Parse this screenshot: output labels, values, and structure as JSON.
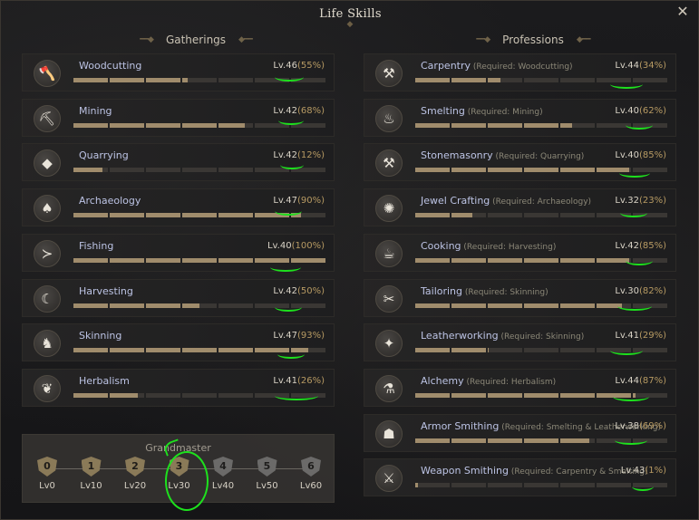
{
  "window": {
    "title": "Life Skills",
    "close_icon": "close-icon"
  },
  "gatherings": {
    "header": "Gatherings",
    "skills": [
      {
        "name": "Woodcutting",
        "level": "Lv.46",
        "percent": "(55%)",
        "progress": 0.45,
        "icon": "axe-icon"
      },
      {
        "name": "Mining",
        "level": "Lv.42",
        "percent": "(68%)",
        "progress": 0.68,
        "icon": "pickaxe-icon"
      },
      {
        "name": "Quarrying",
        "level": "Lv.42",
        "percent": "(12%)",
        "progress": 0.12,
        "icon": "rock-icon"
      },
      {
        "name": "Archaeology",
        "level": "Lv.47",
        "percent": "(90%)",
        "progress": 0.9,
        "icon": "shovel-icon"
      },
      {
        "name": "Fishing",
        "level": "Lv.40",
        "percent": "(100%)",
        "progress": 1.0,
        "icon": "fish-icon"
      },
      {
        "name": "Harvesting",
        "level": "Lv.42",
        "percent": "(50%)",
        "progress": 0.5,
        "icon": "sickle-icon"
      },
      {
        "name": "Skinning",
        "level": "Lv.47",
        "percent": "(93%)",
        "progress": 0.93,
        "icon": "bear-icon"
      },
      {
        "name": "Herbalism",
        "level": "Lv.41",
        "percent": "(26%)",
        "progress": 0.26,
        "icon": "leaf-icon"
      }
    ]
  },
  "professions": {
    "header": "Professions",
    "skills": [
      {
        "name": "Carpentry",
        "req": "(Required: Woodcutting)",
        "level": "Lv.44",
        "percent": "(34%)",
        "progress": 0.34,
        "icon": "saw-icon"
      },
      {
        "name": "Smelting",
        "req": "(Required: Mining)",
        "level": "Lv.40",
        "percent": "(62%)",
        "progress": 0.62,
        "icon": "furnace-icon"
      },
      {
        "name": "Stonemasonry",
        "req": "(Required: Quarrying)",
        "level": "Lv.40",
        "percent": "(85%)",
        "progress": 0.85,
        "icon": "hammer-icon"
      },
      {
        "name": "Jewel Crafting",
        "req": "(Required: Archaeology)",
        "level": "Lv.32",
        "percent": "(23%)",
        "progress": 0.23,
        "icon": "gem-icon"
      },
      {
        "name": "Cooking",
        "req": "(Required: Harvesting)",
        "level": "Lv.42",
        "percent": "(85%)",
        "progress": 0.85,
        "icon": "pot-icon"
      },
      {
        "name": "Tailoring",
        "req": "(Required: Skinning)",
        "level": "Lv.30",
        "percent": "(82%)",
        "progress": 0.82,
        "icon": "needle-icon"
      },
      {
        "name": "Leatherworking",
        "req": "(Required: Skinning)",
        "level": "Lv.41",
        "percent": "(29%)",
        "progress": 0.29,
        "icon": "leather-icon"
      },
      {
        "name": "Alchemy",
        "req": "(Required: Herbalism)",
        "level": "Lv.44",
        "percent": "(87%)",
        "progress": 0.87,
        "icon": "flask-icon"
      },
      {
        "name": "Armor Smithing",
        "req": "(Required: Smelting & Leatherworking)",
        "level": "Lv.38",
        "percent": "(69%)",
        "progress": 0.69,
        "icon": "helmet-icon"
      },
      {
        "name": "Weapon Smithing",
        "req": "(Required: Carpentry & Smelting)",
        "level": "Lv.43",
        "percent": "(1%)",
        "progress": 0.01,
        "icon": "sword-icon"
      }
    ]
  },
  "mastery": {
    "title": "Grandmaster",
    "tiers": [
      {
        "num": "0",
        "label": "Lv0",
        "unlocked": true
      },
      {
        "num": "1",
        "label": "Lv10",
        "unlocked": true
      },
      {
        "num": "2",
        "label": "Lv20",
        "unlocked": true
      },
      {
        "num": "3",
        "label": "Lv30",
        "unlocked": true
      },
      {
        "num": "4",
        "label": "Lv40",
        "unlocked": false
      },
      {
        "num": "5",
        "label": "Lv50",
        "unlocked": false
      },
      {
        "num": "6",
        "label": "Lv60",
        "unlocked": false
      }
    ]
  },
  "colors": {
    "bar_fill": "#a08c6c",
    "bar_empty": "#3a3734",
    "annotation": "#1de11d",
    "skill_name": "#bcc3e4",
    "percent": "#b79a63"
  }
}
